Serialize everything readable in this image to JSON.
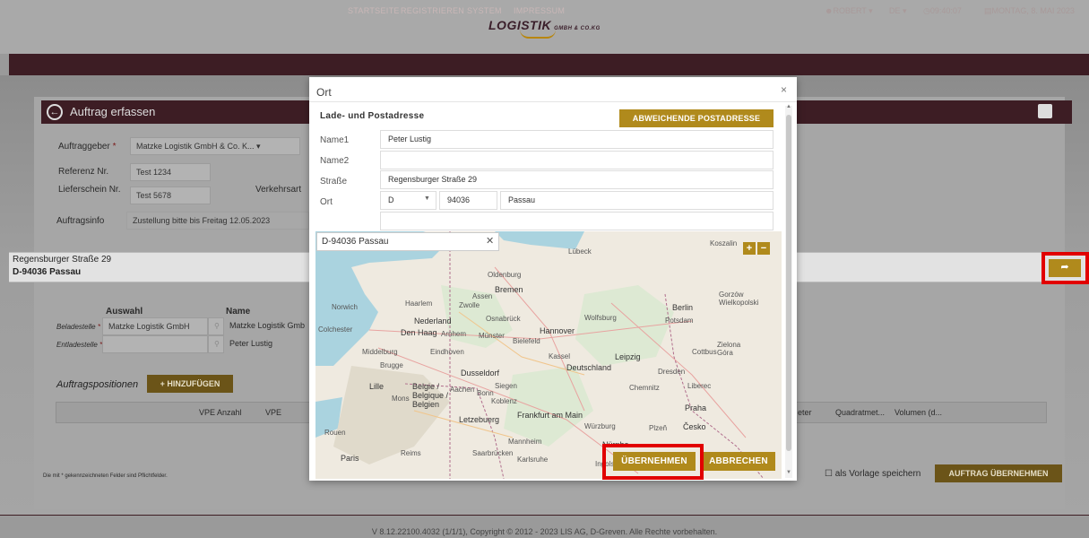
{
  "app": {
    "logo_text": "LOGISTIK",
    "logo_sub": "GMBH & CO.KG",
    "nav": [
      "STARTSEITE",
      "REGISTRIEREN",
      "SYSTEM",
      "IMPRESSUM"
    ],
    "user": "ROBERT",
    "lang": "DE",
    "timer": "09:40:07",
    "date": "MONTAG, 8. MAI 2023",
    "page_title": "Auftrag erfassen",
    "footer": "V 8.12.22100.4032 (1/1/1), Copyright © 2012 - 2023 LIS AG, D-Greven. Alle Rechte vorbehalten."
  },
  "form": {
    "auftraggeber_label": "Auftraggeber",
    "auftraggeber_value": "Matzke Logistik GmbH & Co. K...",
    "referenz_label": "Referenz Nr.",
    "referenz_value": "Test 1234",
    "lieferschein_label": "Lieferschein Nr.",
    "lieferschein_value": "Test 5678",
    "verkehrsart_label": "Verkehrsart",
    "auftragsinfo_label": "Auftragsinfo",
    "auftragsinfo_value": "Zustellung bitte bis Freitag 12.05.2023",
    "auswahl_header": "Auswahl",
    "name_header": "Name",
    "beladestelle_label": "Beladestelle",
    "beladestelle_value": "Matzke Logistik GmbH",
    "beladestelle_name": "Matzke Logistik Gmb",
    "entladestelle_label": "Entladestelle",
    "entladestelle_name": "Peter Lustig",
    "positionen_label": "Auftragspositionen",
    "hinzufuegen": "+ HINZUFÜGEN",
    "columns": [
      "VPE Anzahl",
      "VPE",
      "eter",
      "Quadratmet...",
      "Volumen (d..."
    ],
    "required_note": "Die mit * gekennzeichneten Felder sind Pflichtfelder.",
    "vorlage_label": "als Vorlage speichern",
    "auftrag_uebernehmen": "AUFTRAG ÜBERNEHMEN"
  },
  "strip": {
    "line1": "Regensburger Straße 29",
    "line2": "D-94036 Passau",
    "go_icon": "arrow-icon"
  },
  "modal": {
    "title": "Ort",
    "close": "×",
    "section_title": "Lade- und Postadresse",
    "abweichende": "ABWEICHENDE POSTADRESSE",
    "name1_label": "Name1",
    "name1_value": "Peter Lustig",
    "name2_label": "Name2",
    "name2_value": "",
    "strasse_label": "Straße",
    "strasse_value": "Regensburger Straße 29",
    "ort_label": "Ort",
    "country": "D",
    "plz": "94036",
    "city": "Passau",
    "map_search": "D-94036 Passau",
    "uebernehmen": "ÜBERNEHMEN",
    "abbrechen": "ABBRECHEN"
  },
  "map": {
    "places": [
      "Bremen",
      "Hannover",
      "Berlin",
      "Potsdam",
      "Leipzig",
      "Dresden",
      "Kassel",
      "Dusseldorf",
      "Deutschland",
      "Frankfurt am Main",
      "Würzburg",
      "Nürnbe",
      "Praha",
      "Česko",
      "Chemnitz",
      "Den Haag",
      "Nederland",
      "Arnhem",
      "Eindhoven",
      "Brugge",
      "Lille",
      "Belgie / Belgique / Belgien",
      "Letzebuerg",
      "Paris",
      "Reims",
      "Mannheim",
      "Karlsruhe",
      "Saarbrücken",
      "Ingolstadt",
      "Rouen",
      "Lübeck",
      "Koszalin",
      "Gorzów Wielkopolski",
      "Osnabrück",
      "Wolfsburg",
      "Bielefeld",
      "Münster",
      "Siegen",
      "Koblenz",
      "Aachen",
      "Bonn",
      "Liberec",
      "Zielona Góra",
      "Cottbus",
      "Middelburg",
      "Zwolle",
      "Haarlem",
      "Assen",
      "Oldenburg",
      "Norwich",
      "Colchester",
      "Mons",
      "Plzeň"
    ]
  }
}
